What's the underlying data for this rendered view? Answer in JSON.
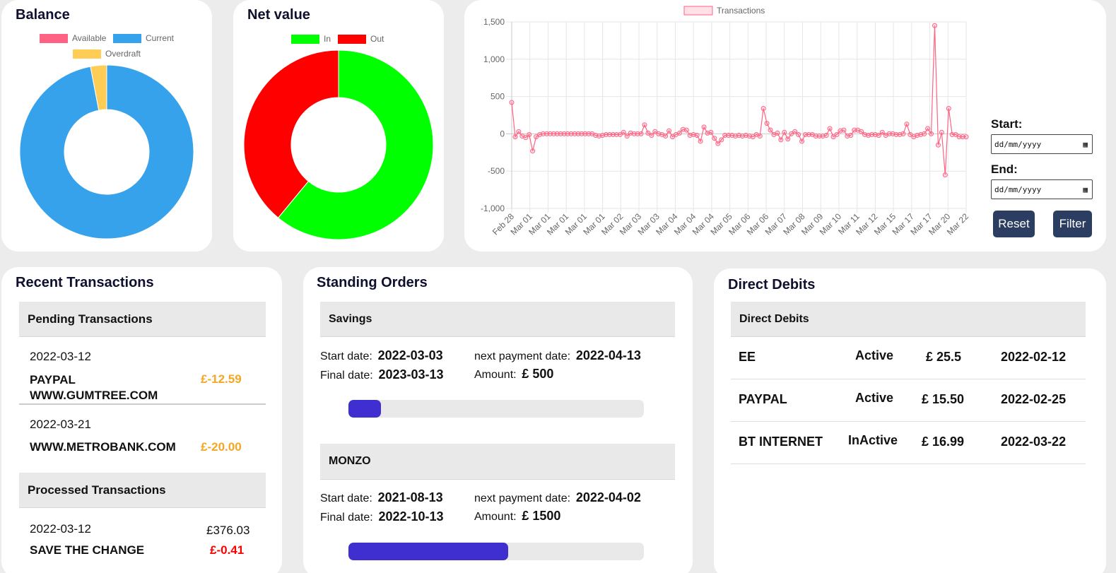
{
  "balance": {
    "title": "Balance",
    "legend": [
      {
        "label": "Available",
        "color": "#ff6384"
      },
      {
        "label": "Current",
        "color": "#36a2eb"
      },
      {
        "label": "Overdraft",
        "color": "#ffcd56"
      }
    ]
  },
  "net_value": {
    "title": "Net value",
    "legend": [
      {
        "label": "In",
        "color": "#00ff00"
      },
      {
        "label": "Out",
        "color": "#ff0000"
      }
    ]
  },
  "filter": {
    "start_label": "Start:",
    "end_label": "End:",
    "start_value": "dd/mm/yyyy",
    "end_value": "dd/mm/yyyy",
    "reset_label": "Reset",
    "filter_label": "Filter"
  },
  "recent": {
    "title": "Recent Transactions",
    "pending_header": "Pending Transactions",
    "pending": [
      {
        "date": "2022-03-12",
        "name": "PAYPAL WWW.GUMTREE.COM",
        "amount": "£-12.59"
      },
      {
        "date": "2022-03-21",
        "name": "WWW.METROBANK.COM",
        "amount": "£-20.00"
      }
    ],
    "processed_header": "Processed Transactions",
    "processed": [
      {
        "date": "2022-03-12",
        "balance": "£376.03",
        "name": "SAVE THE CHANGE",
        "amount": "£-0.41"
      }
    ]
  },
  "standing": {
    "title": "Standing Orders",
    "start_label": "Start date:",
    "final_label": "Final date:",
    "next_label": "next payment date:",
    "amount_label": "Amount:",
    "orders": [
      {
        "name": "Savings",
        "start": "2022-03-03",
        "final": "2023-03-13",
        "next": "2022-04-13",
        "amount": "£ 500",
        "progress": 0.11
      },
      {
        "name": "MONZO",
        "start": "2021-08-13",
        "final": "2022-10-13",
        "next": "2022-04-02",
        "amount": "£ 1500",
        "progress": 0.54
      }
    ]
  },
  "direct": {
    "title": "Direct Debits",
    "header": "Direct Debits",
    "rows": [
      {
        "name": "EE",
        "status": "Active",
        "amount": "£ 25.5",
        "date": "2022-02-12"
      },
      {
        "name": "PAYPAL",
        "status": "Active",
        "amount": "£ 15.50",
        "date": "2022-02-25"
      },
      {
        "name": "BT INTERNET",
        "status": "InActive",
        "amount": "£ 16.99",
        "date": "2022-03-22"
      }
    ]
  },
  "chart_data": [
    {
      "type": "pie",
      "variant": "doughnut",
      "title": "Balance",
      "labels": [
        "Available",
        "Current",
        "Overdraft"
      ],
      "values": [
        0,
        97,
        3
      ],
      "colors": [
        "#ff6384",
        "#36a2eb",
        "#ffcd56"
      ]
    },
    {
      "type": "pie",
      "variant": "doughnut",
      "title": "Net value",
      "labels": [
        "In",
        "Out"
      ],
      "values": [
        61,
        39
      ],
      "colors": [
        "#00ff00",
        "#ff0000"
      ]
    },
    {
      "type": "line",
      "series": [
        {
          "name": "Transactions",
          "color": "#ff6384"
        }
      ],
      "ylim": [
        -1000,
        1500
      ],
      "yticks": [
        1500,
        1000,
        500,
        0,
        -500,
        -1000
      ],
      "yticklabels": [
        "1,500",
        "1,000",
        "500",
        "0",
        "-500",
        "-1,000"
      ],
      "xticklabels": [
        "Feb 28",
        "Mar 01",
        "Mar 01",
        "Mar 01",
        "Mar 01",
        "Mar 01",
        "Mar 02",
        "Mar 03",
        "Mar 03",
        "Mar 04",
        "Mar 04",
        "Mar 04",
        "Mar 05",
        "Mar 06",
        "Mar 06",
        "Mar 07",
        "Mar 08",
        "Mar 09",
        "Mar 10",
        "Mar 11",
        "Mar 12",
        "Mar 15",
        "Mar 17",
        "Mar 17",
        "Mar 20",
        "Mar 22"
      ],
      "values": [
        420,
        -40,
        30,
        -30,
        -50,
        -10,
        -230,
        -40,
        -10,
        0,
        0,
        0,
        0,
        0,
        0,
        0,
        0,
        0,
        0,
        0,
        0,
        0,
        0,
        0,
        -20,
        -30,
        -20,
        -10,
        -10,
        -10,
        -10,
        -10,
        20,
        -30,
        10,
        0,
        0,
        0,
        120,
        10,
        -20,
        30,
        0,
        -10,
        -30,
        40,
        -40,
        -10,
        10,
        60,
        50,
        -20,
        -10,
        -20,
        -100,
        90,
        10,
        20,
        -60,
        -130,
        -80,
        -20,
        -20,
        -20,
        -30,
        -20,
        -30,
        -20,
        -30,
        -40,
        -10,
        -30,
        340,
        140,
        50,
        -10,
        10,
        -80,
        20,
        -70,
        0,
        30,
        -10,
        -100,
        -10,
        -10,
        -10,
        -30,
        -30,
        -30,
        -20,
        70,
        -40,
        -10,
        40,
        50,
        -30,
        -20,
        50,
        50,
        30,
        -10,
        -20,
        -10,
        -10,
        -20,
        20,
        -20,
        0,
        0,
        -10,
        -10,
        0,
        130,
        -10,
        -40,
        -20,
        -10,
        0,
        70,
        0,
        1450,
        -150,
        20,
        -550,
        340,
        -10,
        -10,
        -40,
        -40,
        -40
      ]
    }
  ]
}
